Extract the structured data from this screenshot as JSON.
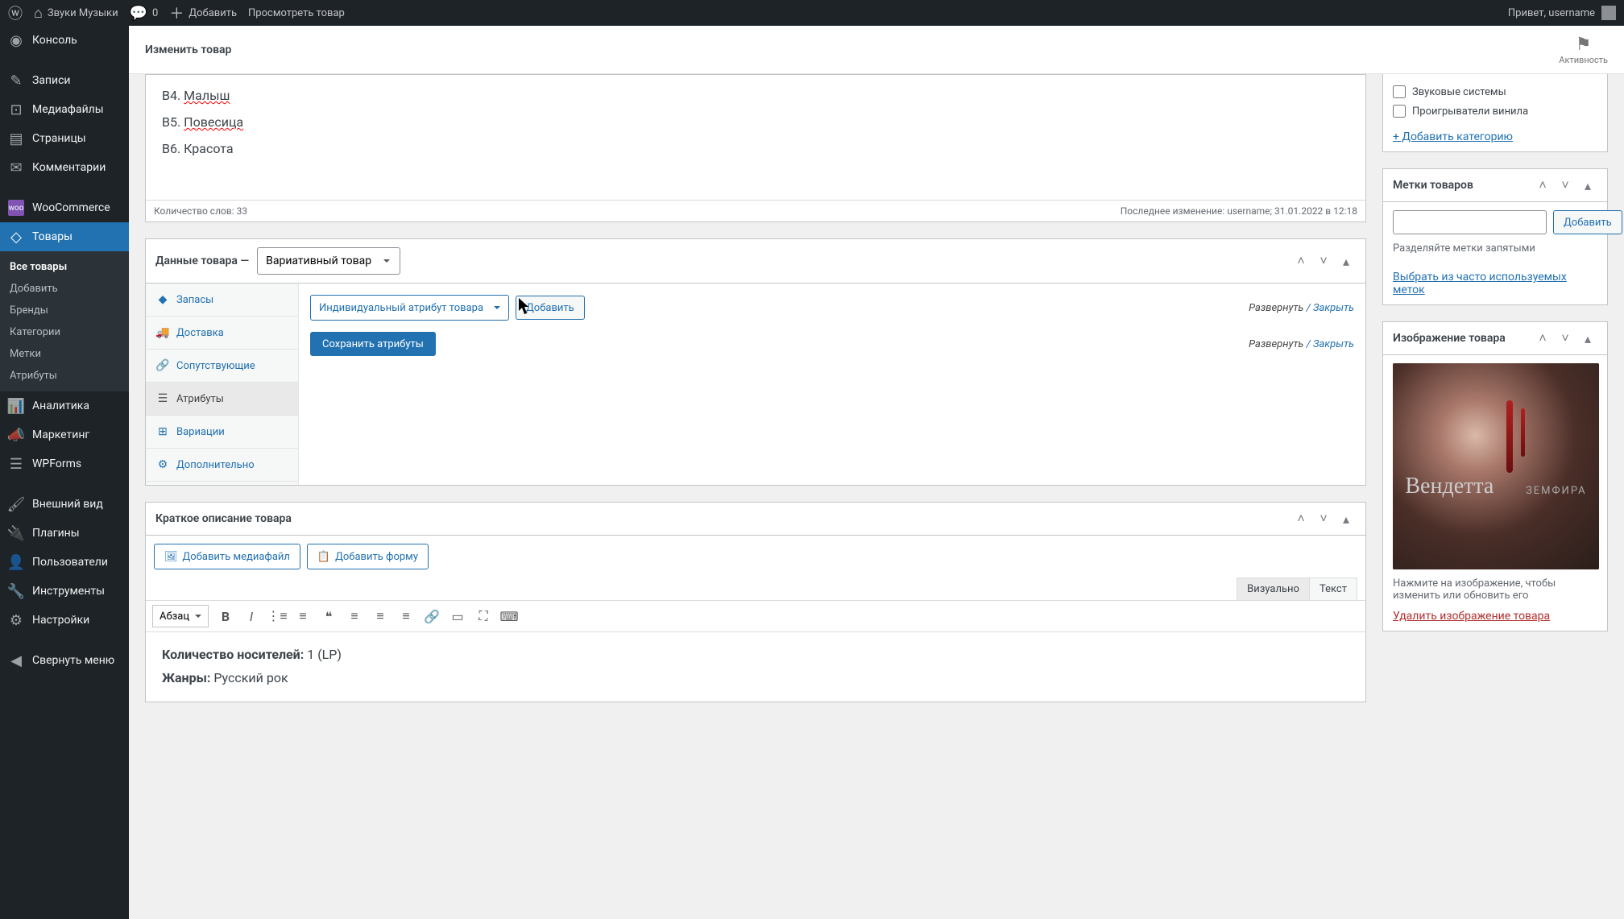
{
  "adminbar": {
    "site_name": "Звуки Музыки",
    "comments": "0",
    "add": "Добавить",
    "view_product": "Просмотреть товар",
    "greeting": "Привет, username"
  },
  "sidebar": {
    "console": "Консоль",
    "posts": "Записи",
    "media": "Медиафайлы",
    "pages": "Страницы",
    "comments": "Комментарии",
    "woocommerce": "WooCommerce",
    "products": "Товары",
    "products_sub": {
      "all": "Все товары",
      "add": "Добавить",
      "brands": "Бренды",
      "categories": "Категории",
      "tags": "Метки",
      "attributes": "Атрибуты"
    },
    "analytics": "Аналитика",
    "marketing": "Маркетинг",
    "wpforms": "WPForms",
    "appearance": "Внешний вид",
    "plugins": "Плагины",
    "users": "Пользователи",
    "tools": "Инструменты",
    "settings": "Настройки",
    "collapse": "Свернуть меню"
  },
  "page": {
    "title": "Изменить товар",
    "activity": "Активность"
  },
  "editor": {
    "lines": {
      "b4_prefix": "B4. ",
      "b4_word": "Малыш",
      "b5_prefix": "B5. ",
      "b5_word": "Повесица",
      "b6": "B6. Красота"
    },
    "word_count": "Количество слов: 33",
    "last_edit": "Последнее изменение: username; 31.01.2022 в 12:18"
  },
  "product_data": {
    "title": "Данные товара —",
    "type_select": "Вариативный товар",
    "tabs": {
      "inventory": "Запасы",
      "shipping": "Доставка",
      "linked": "Сопутствующие",
      "attributes": "Атрибуты",
      "variations": "Вариации",
      "advanced": "Дополнительно"
    },
    "attr_select": "Индивидуальный атрибут товара",
    "add_btn": "Добавить",
    "expand": "Развернуть",
    "close": "Закрыть",
    "save": "Сохранить атрибуты"
  },
  "short_desc": {
    "title": "Краткое описание товара",
    "add_media": "Добавить медиафайл",
    "add_form": "Добавить форму",
    "visual": "Визуально",
    "text": "Текст",
    "format_select": "Абзац",
    "content": {
      "line1_label": "Количество носителей:",
      "line1_value": " 1 (LP)",
      "line2_label": "Жанры:",
      "line2_value": " Русский рок"
    }
  },
  "categories_box": {
    "cb1": "Звуковые системы",
    "cb2": "Проигрыватели винила",
    "add_link": "+ Добавить категорию"
  },
  "tags_box": {
    "title": "Метки товаров",
    "add_btn": "Добавить",
    "hint": "Разделяйте метки запятыми",
    "choose_link": "Выбрать из часто используемых меток"
  },
  "image_box": {
    "title": "Изображение товара",
    "hint": "Нажмите на изображение, чтобы изменить или обновить его",
    "remove_link": "Удалить изображение товара",
    "album_title": "Вендетта",
    "album_artist": "ЗЕМФИРА"
  }
}
